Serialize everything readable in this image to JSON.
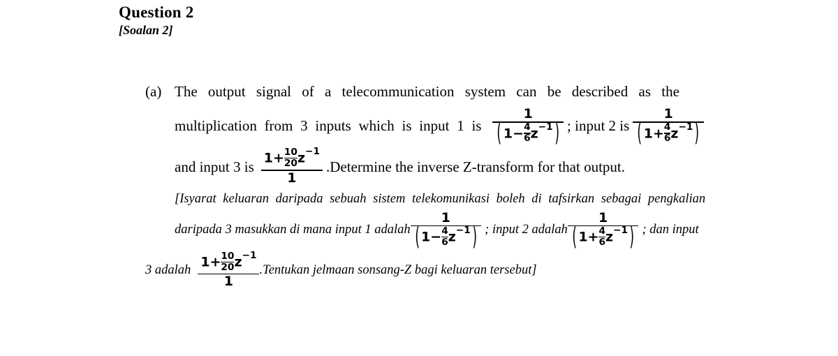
{
  "heading": {
    "title": "Question 2",
    "subtitle": "[Soalan 2]"
  },
  "part_a": {
    "label": "(a)",
    "english": {
      "line1": "The  output  signal  of  a  telecommunication  system  can  be  described  as  the",
      "line2_pre": "multiplication from 3 inputs which is input 1 is",
      "sep1": "; input 2 is",
      "line3_pre": "and input 3 is",
      "line3_post": ".Determine  the inverse Z-transform for that output."
    },
    "malay": {
      "line1": "[Isyarat keluaran daripada sebuah  sistem telekomunikasi boleh di tafsirkan sebagai pengkalian",
      "line2_pre": "daripada 3 masukkan di mana input 1 adalah",
      "sep1": "; input 2 adalah",
      "sep2": "; dan input",
      "line3_pre": "3 adalah",
      "line3_post": ".Tentukan jelmaan sonsang-Z bagi keluaran tersebut]"
    },
    "math": {
      "input1": {
        "numerator": "1",
        "den_one": "1",
        "den_sign": "−",
        "den_frac_num": "4",
        "den_frac_den": "6",
        "den_var": "z",
        "den_exp": "−1",
        "paren_open": "(",
        "paren_close": ")"
      },
      "input2": {
        "numerator": "1",
        "den_one": "1",
        "den_sign": "+",
        "den_frac_num": "4",
        "den_frac_den": "6",
        "den_var": "z",
        "den_exp": "−1",
        "paren_open": "(",
        "paren_close": ")"
      },
      "input3": {
        "num_one": "1",
        "num_sign": "+",
        "num_frac_num": "10",
        "num_frac_den": "20",
        "num_var": "z",
        "num_exp": "−1",
        "denominator": "1"
      }
    }
  },
  "colors": {
    "text": "#000000",
    "background": "#ffffff"
  }
}
